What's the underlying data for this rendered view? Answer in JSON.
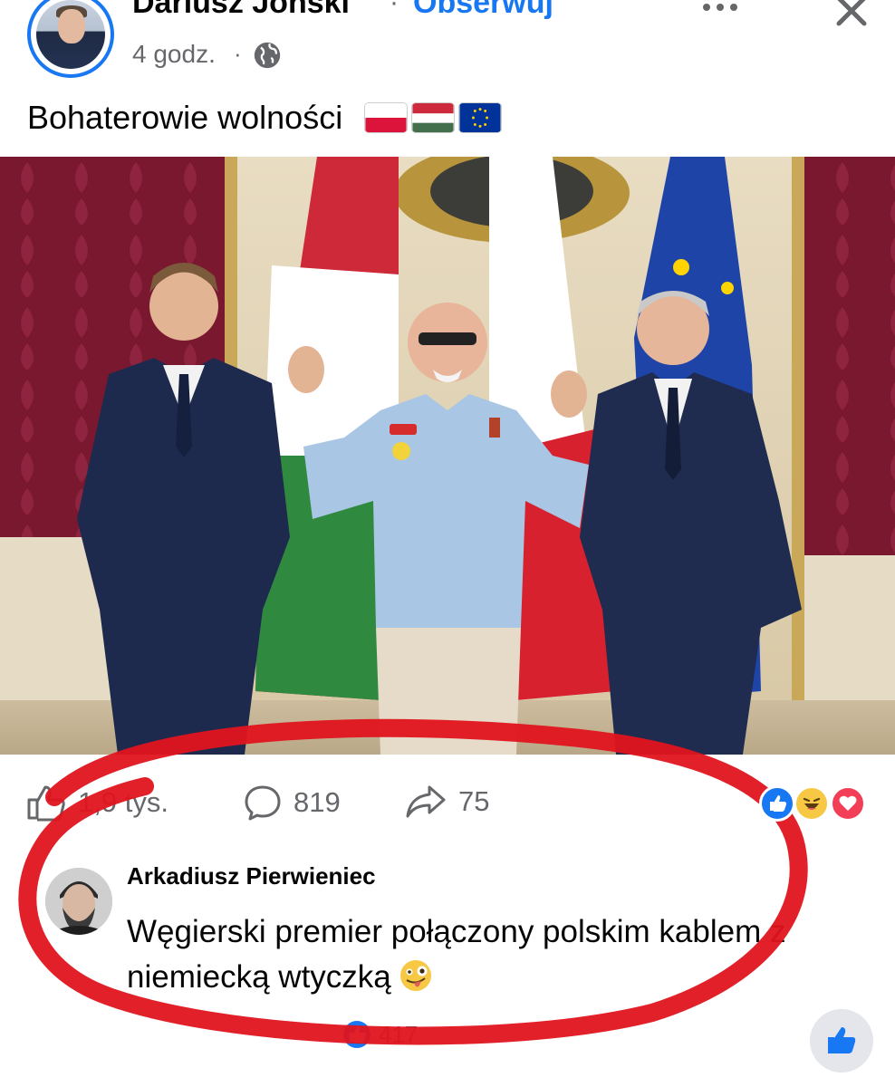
{
  "header": {
    "author_name": "Dariusz Joński",
    "separator": "·",
    "follow_label": "Obserwuj",
    "time": "4 godz.",
    "time_separator": "·",
    "audience_icon": "globe-icon",
    "more_icon": "more-horizontal-icon",
    "close_icon": "close-icon"
  },
  "post": {
    "caption": "Bohaterowie wolności",
    "caption_flags": [
      "poland-flag-emoji",
      "hungary-flag-emoji",
      "eu-flag-emoji"
    ]
  },
  "stats": {
    "likes": "1,9 tys.",
    "comments": "819",
    "shares": "75",
    "reactions": [
      "like-reaction-icon",
      "haha-reaction-icon",
      "love-reaction-icon"
    ]
  },
  "comment": {
    "author": "Arkadiusz Pierwieniec",
    "text": "Węgierski premier połączony polskim kablem z niemiecką wtyczką",
    "emoji": "winking-tongue-emoji",
    "likes": "417"
  },
  "colors": {
    "accent": "#1877f2",
    "secondary_text": "#65676b",
    "marker": "#e0141e"
  }
}
